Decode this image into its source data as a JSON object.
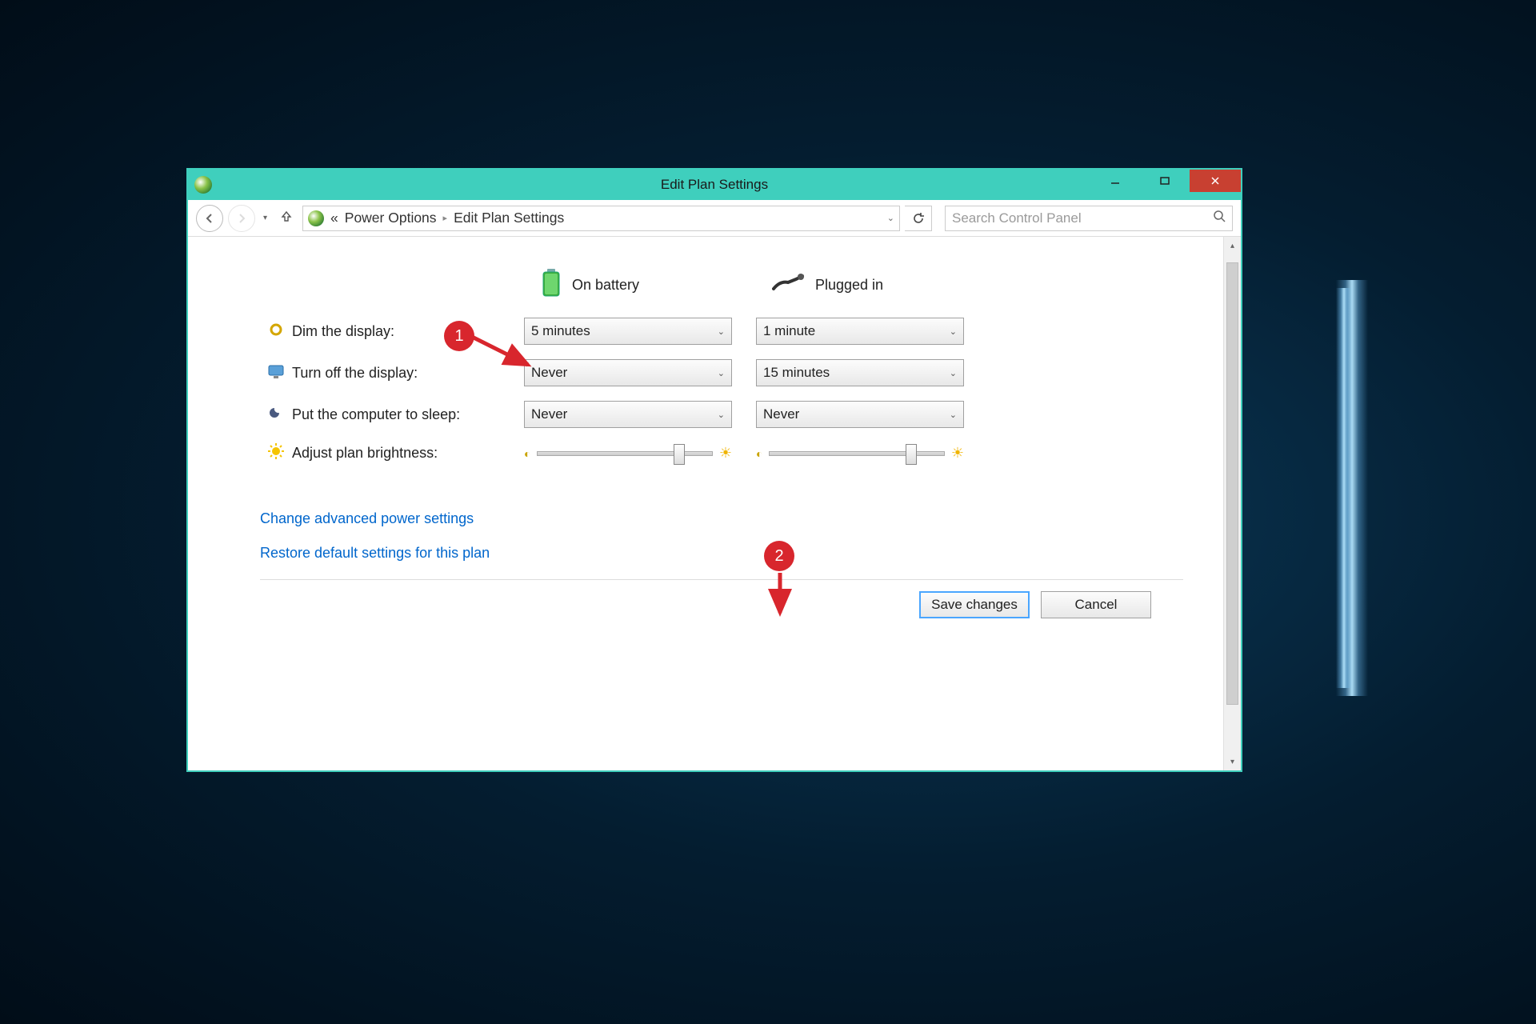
{
  "window": {
    "title": "Edit Plan Settings"
  },
  "breadcrumb": {
    "prefix": "«",
    "items": [
      "Power Options",
      "Edit Plan Settings"
    ]
  },
  "search": {
    "placeholder": "Search Control Panel"
  },
  "columns": {
    "battery": "On battery",
    "plugged": "Plugged in"
  },
  "rows": {
    "dim": {
      "label": "Dim the display:",
      "battery": "5 minutes",
      "plugged": "1 minute"
    },
    "turnoff": {
      "label": "Turn off the display:",
      "battery": "Never",
      "plugged": "15 minutes"
    },
    "sleep": {
      "label": "Put the computer to sleep:",
      "battery": "Never",
      "plugged": "Never"
    },
    "brightness": {
      "label": "Adjust plan brightness:"
    }
  },
  "links": {
    "advanced": "Change advanced power settings",
    "restore": "Restore default settings for this plan"
  },
  "buttons": {
    "save": "Save changes",
    "cancel": "Cancel"
  },
  "annotations": {
    "one": "1",
    "two": "2"
  }
}
